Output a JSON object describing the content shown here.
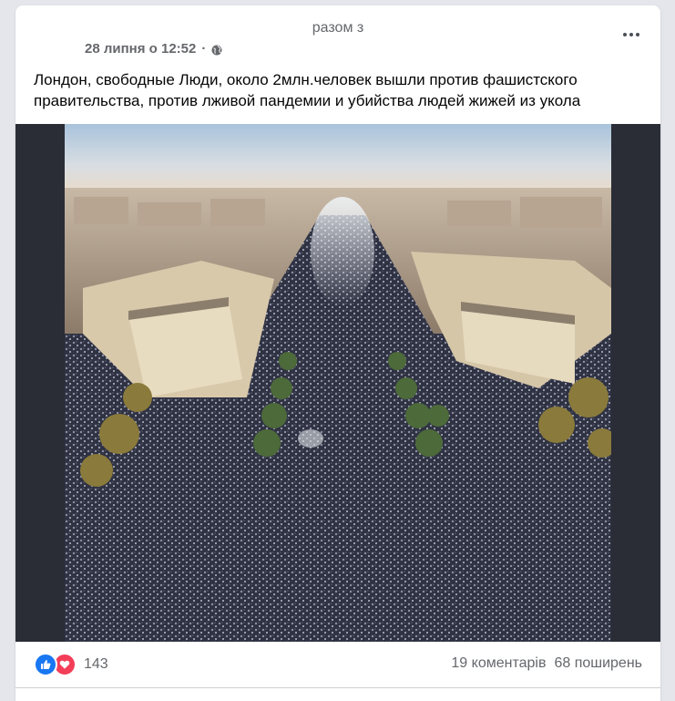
{
  "post": {
    "with_label": "разом з",
    "timestamp": "28 липня о 12:52",
    "separator": "·",
    "audience_icon": "globe-icon",
    "more_icon": "more-options-icon",
    "text": "Лондон, свободные Люди, около 2млн.человек вышли против фашистского правительства, против лживой пандемии и убийства людей жижей из укола"
  },
  "media": {
    "photo_icon": "crowd-aerial-photo"
  },
  "footer": {
    "reaction_icons": [
      "like-icon",
      "love-icon"
    ],
    "reaction_count": "143",
    "comments": "19 коментарів",
    "shares": "68 поширень"
  },
  "colors": {
    "like": "#1877f2",
    "love": "#f33e58",
    "secondary_text": "#65676b",
    "media_bg": "#2a2d36"
  }
}
